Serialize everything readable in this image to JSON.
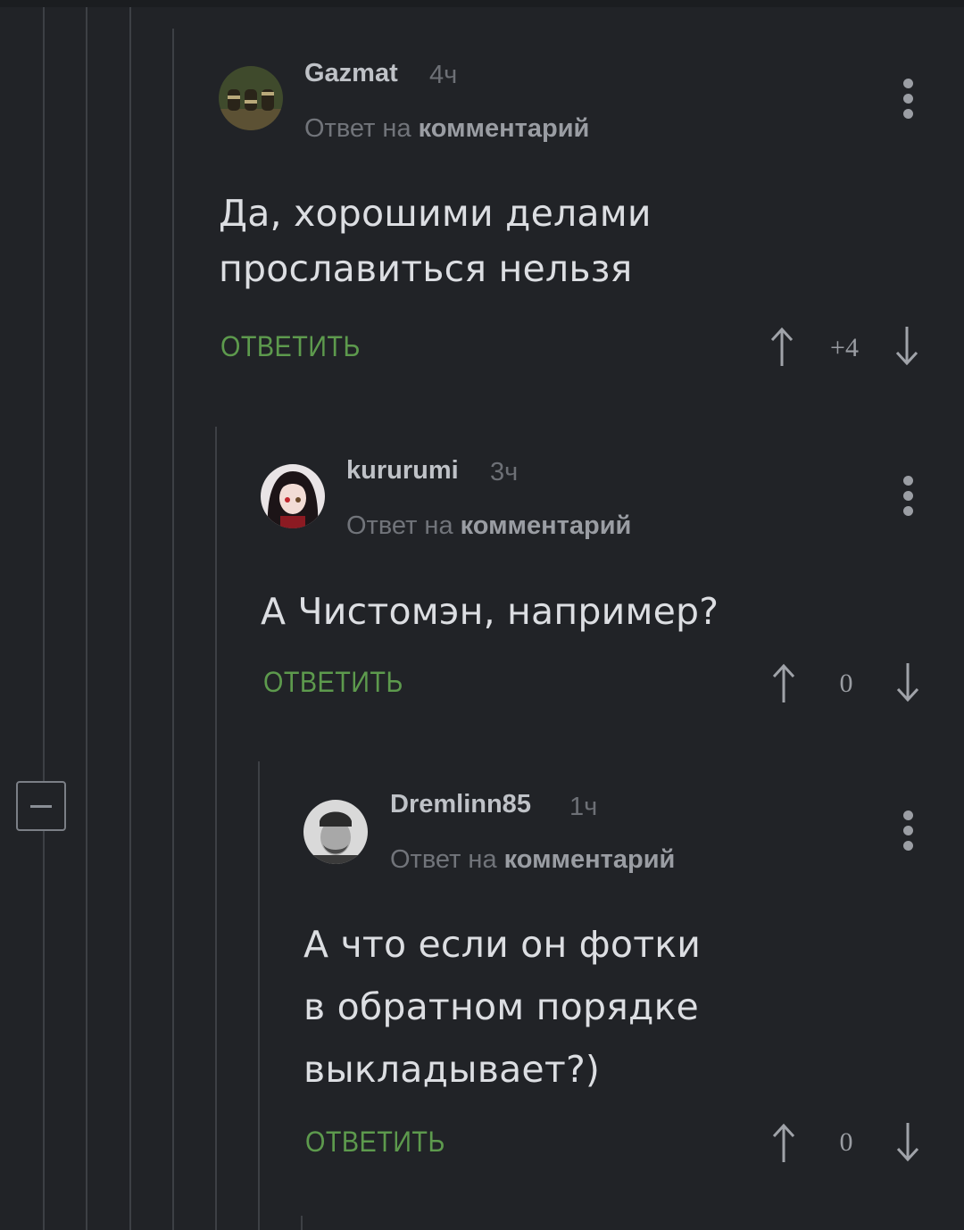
{
  "comments": [
    {
      "username": "Gazmat",
      "time": "4ч",
      "reply_prefix": "Ответ на",
      "reply_target": "комментарий",
      "text_lines": [
        "Да, хорошими делами",
        "прославиться нельзя"
      ],
      "reply_label": "ОТВЕТИТЬ",
      "score": "+4"
    },
    {
      "username": "kururumi",
      "time": "3ч",
      "reply_prefix": "Ответ на",
      "reply_target": "комментарий",
      "text_lines": [
        "А Чистомэн, например?"
      ],
      "reply_label": "ОТВЕТИТЬ",
      "score": "0"
    },
    {
      "username": "Dremlinn85",
      "time": "1ч",
      "reply_prefix": "Ответ на",
      "reply_target": "комментарий",
      "text_lines": [
        "А что если он фотки",
        "в обратном порядке",
        "выкладывает?)"
      ],
      "reply_label": "ОТВЕТИТЬ",
      "score": "0"
    }
  ],
  "icons": {
    "menu": "more-vertical-icon",
    "upvote": "arrow-up-icon",
    "downvote": "arrow-down-icon",
    "collapse": "minus-square-icon"
  },
  "colors": {
    "background": "#212327",
    "accent_green": "#5d9a4d",
    "thread_line": "#3d4045"
  }
}
